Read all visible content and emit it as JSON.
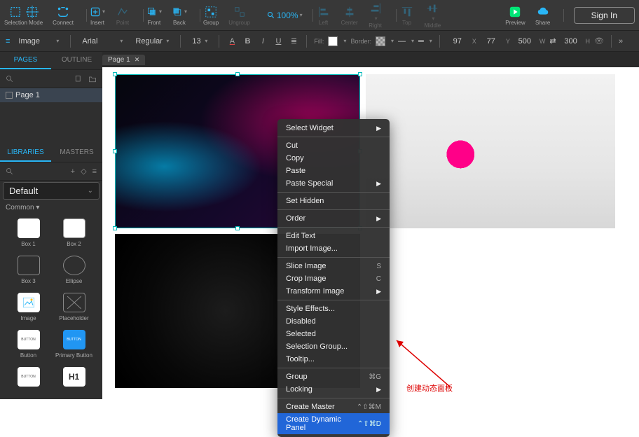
{
  "topbar": {
    "selection_mode": "Selection Mode",
    "connect": "Connect",
    "insert": "Insert",
    "point": "Point",
    "front": "Front",
    "back": "Back",
    "group": "Group",
    "ungroup": "Ungroup",
    "zoom": "100%",
    "left": "Left",
    "center": "Center",
    "right": "Right",
    "top": "Top",
    "middle": "Middle",
    "preview": "Preview",
    "share": "Share",
    "signin": "Sign In"
  },
  "propbar": {
    "widget_type": "Image",
    "font": "Arial",
    "weight": "Regular",
    "size": "13",
    "fill_label": "Fill:",
    "border_label": "Border:",
    "x": "97",
    "x_lbl": "X",
    "y": "77",
    "y_lbl": "Y",
    "w": "500",
    "w_lbl": "W",
    "h": "300",
    "h_lbl": "H"
  },
  "tabs": {
    "page1": "Page 1"
  },
  "leftpanel": {
    "tabs": {
      "pages": "PAGES",
      "outline": "OUTLINE",
      "libraries": "LIBRARIES",
      "masters": "MASTERS"
    },
    "page1": "Page 1",
    "default_lib": "Default",
    "common": "Common ▾",
    "items": {
      "box1": "Box 1",
      "box2": "Box 2",
      "box3": "Box 3",
      "ellipse": "Ellipse",
      "image": "Image",
      "placeholder": "Placeholder",
      "button": "Button",
      "primary_button": "Primary Button",
      "h1": "H1"
    }
  },
  "context_menu": {
    "select_widget": "Select Widget",
    "cut": "Cut",
    "copy": "Copy",
    "paste": "Paste",
    "paste_special": "Paste Special",
    "set_hidden": "Set Hidden",
    "order": "Order",
    "edit_text": "Edit Text",
    "import_image": "Import Image...",
    "slice_image": "Slice Image",
    "slice_sc": "S",
    "crop_image": "Crop Image",
    "crop_sc": "C",
    "transform_image": "Transform Image",
    "style_effects": "Style Effects...",
    "disabled": "Disabled",
    "selected": "Selected",
    "selection_group": "Selection Group...",
    "tooltip": "Tooltip...",
    "group": "Group",
    "group_sc": "⌘G",
    "locking": "Locking",
    "create_master": "Create Master",
    "create_master_sc": "⌃⇧⌘M",
    "create_dynamic_panel": "Create Dynamic Panel",
    "create_dp_sc": "⌃⇧⌘D"
  },
  "annotation": "创建动态面板"
}
